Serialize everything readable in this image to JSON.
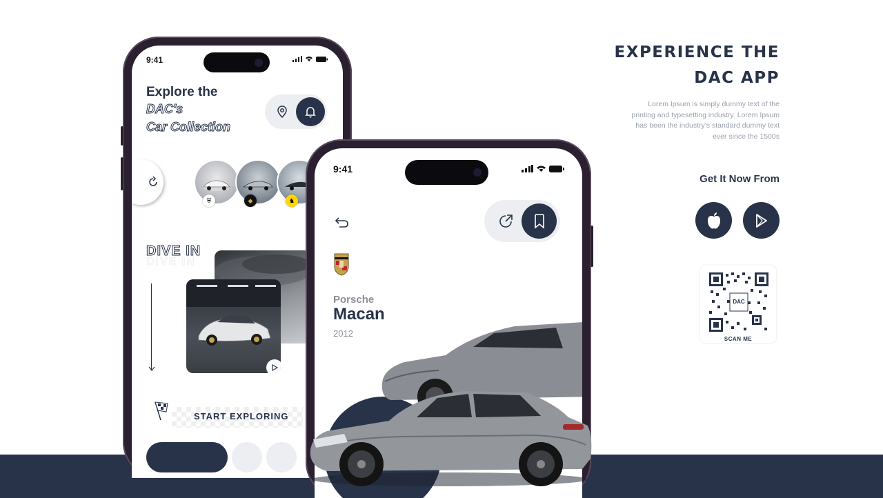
{
  "colors": {
    "primary": "#283349",
    "muted": "#9aa0ab",
    "pill": "#eceef1"
  },
  "phone_left": {
    "time": "9:41",
    "title": "Explore the",
    "title_line2": "DAC's",
    "title_line3": "Car Collection",
    "icons": {
      "location": "location-pin-icon",
      "bell": "bell-icon",
      "refresh": "refresh-icon"
    },
    "section_title": "DIVE IN",
    "cta": "START EXPLORING"
  },
  "phone_right": {
    "time": "9:41",
    "brand": "Porsche",
    "model": "Macan",
    "year": "2012",
    "icons": {
      "back": "undo-arrow-icon",
      "share": "share-icon",
      "bookmark": "bookmark-icon"
    }
  },
  "marketing": {
    "headline_line1": "EXPERIENCE THE",
    "headline_line2": "DAC APP",
    "description": "Lorem Ipsum is simply dummy text of the printing and typesetting industry. Lorem Ipsum has been the industry's standard dummy text ever since the 1500s",
    "get_it": "Get It Now From",
    "qr_label": "SCAN ME",
    "qr_logo": "DAC"
  }
}
